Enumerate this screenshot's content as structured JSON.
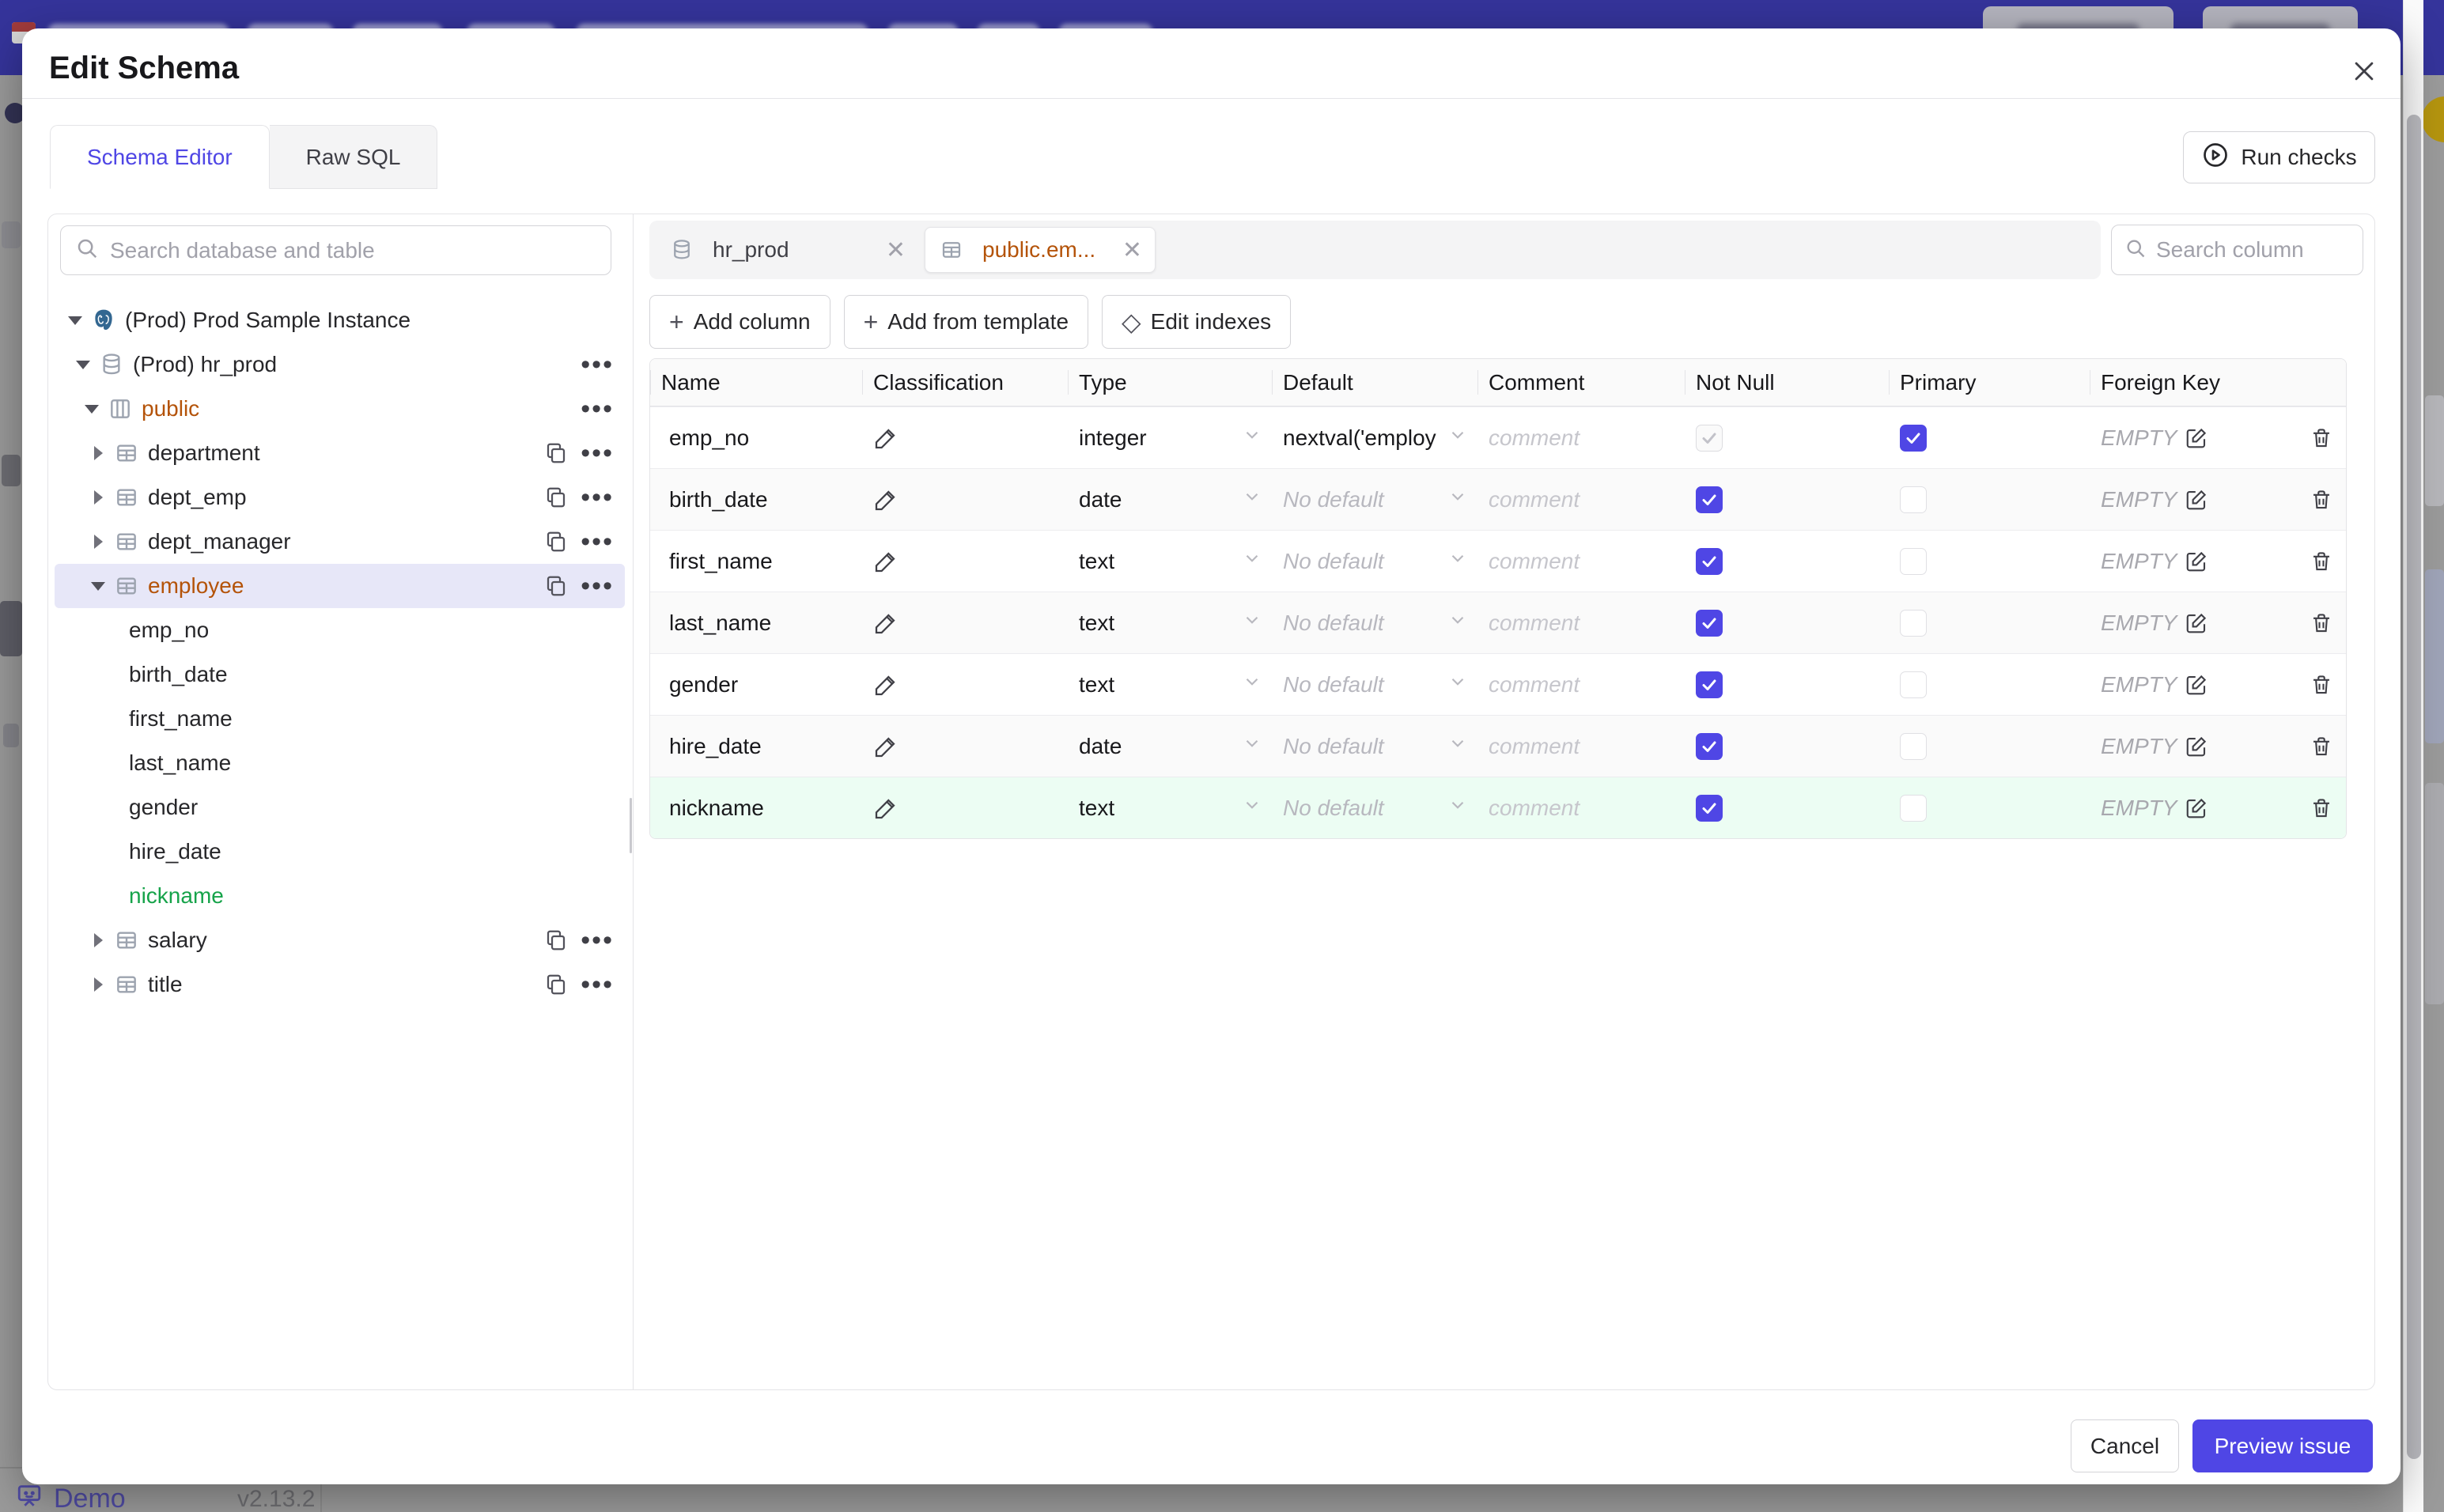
{
  "colors": {
    "accent": "#4f46e5",
    "schema_amber": "#b45309",
    "added_green": "#16a34a",
    "app_header_purple": "#35349b"
  },
  "overlay": {
    "demo_label": "Demo",
    "version": "v2.13.2"
  },
  "modal": {
    "title": "Edit Schema",
    "close_icon": "x",
    "tabs": [
      {
        "label": "Schema Editor",
        "active": true
      },
      {
        "label": "Raw SQL",
        "active": false
      }
    ],
    "run_checks_label": "Run checks",
    "sidebar": {
      "search_placeholder": "Search database and table",
      "tree": [
        {
          "label": "(Prod) Prod Sample Instance",
          "lvl": "lvl0",
          "arrow": "down",
          "icon": "pg"
        },
        {
          "label": "(Prod) hr_prod",
          "lvl": "lvl1",
          "arrow": "down",
          "icon": "db",
          "more": true
        },
        {
          "label": "public",
          "lvl": "lvl2",
          "arrow": "down",
          "icon": "schema",
          "amber": true,
          "more": true
        },
        {
          "label": "department",
          "lvl": "lvl3",
          "arrow": "right",
          "icon": "table",
          "copy": true,
          "more": true
        },
        {
          "label": "dept_emp",
          "lvl": "lvl3",
          "arrow": "right",
          "icon": "table",
          "copy": true,
          "more": true
        },
        {
          "label": "dept_manager",
          "lvl": "lvl3",
          "arrow": "right",
          "icon": "table",
          "copy": true,
          "more": true
        },
        {
          "label": "employee",
          "lvl": "lvl3",
          "arrow": "down",
          "icon": "table",
          "amber": true,
          "selected": true,
          "copy": true,
          "more": true
        },
        {
          "label": "emp_no",
          "lvl": "lvl4",
          "arrow": ""
        },
        {
          "label": "birth_date",
          "lvl": "lvl4",
          "arrow": ""
        },
        {
          "label": "first_name",
          "lvl": "lvl4",
          "arrow": ""
        },
        {
          "label": "last_name",
          "lvl": "lvl4",
          "arrow": ""
        },
        {
          "label": "gender",
          "lvl": "lvl4",
          "arrow": ""
        },
        {
          "label": "hire_date",
          "lvl": "lvl4",
          "arrow": ""
        },
        {
          "label": "nickname",
          "lvl": "lvl4",
          "arrow": "",
          "green": true
        },
        {
          "label": "salary",
          "lvl": "lvl3",
          "arrow": "right",
          "icon": "table",
          "copy": true,
          "more": true
        },
        {
          "label": "title",
          "lvl": "lvl3",
          "arrow": "right",
          "icon": "table",
          "copy": true,
          "more": true
        }
      ]
    },
    "editor": {
      "chips": [
        {
          "label": "hr_prod",
          "icon": "db",
          "active": false,
          "amber": false
        },
        {
          "label": "public.em...",
          "icon": "table",
          "active": true,
          "amber": true
        }
      ],
      "toolbar": [
        {
          "label": "Add column",
          "icon": "plus"
        },
        {
          "label": "Add from template",
          "icon": "plus"
        },
        {
          "label": "Edit indexes",
          "icon": "diamond"
        }
      ],
      "search_placeholder": "Search column",
      "columns_table": {
        "headers": [
          "Name",
          "Classification",
          "Type",
          "Default",
          "Comment",
          "Not Null",
          "Primary",
          "Foreign Key"
        ],
        "comment_placeholder": "comment",
        "fk_empty": "EMPTY",
        "rows": [
          {
            "name": "emp_no",
            "type": "integer",
            "default": "nextval('employ",
            "no_default": false,
            "not_null": true,
            "nn_disabled": true,
            "primary": true,
            "shade": ""
          },
          {
            "name": "birth_date",
            "type": "date",
            "default": "No default",
            "no_default": true,
            "not_null": true,
            "nn_disabled": false,
            "primary": false,
            "shade": "alt"
          },
          {
            "name": "first_name",
            "type": "text",
            "default": "No default",
            "no_default": true,
            "not_null": true,
            "nn_disabled": false,
            "primary": false,
            "shade": ""
          },
          {
            "name": "last_name",
            "type": "text",
            "default": "No default",
            "no_default": true,
            "not_null": true,
            "nn_disabled": false,
            "primary": false,
            "shade": "alt"
          },
          {
            "name": "gender",
            "type": "text",
            "default": "No default",
            "no_default": true,
            "not_null": true,
            "nn_disabled": false,
            "primary": false,
            "shade": ""
          },
          {
            "name": "hire_date",
            "type": "date",
            "default": "No default",
            "no_default": true,
            "not_null": true,
            "nn_disabled": false,
            "primary": false,
            "shade": "alt"
          },
          {
            "name": "nickname",
            "type": "text",
            "default": "No default",
            "no_default": true,
            "not_null": true,
            "nn_disabled": false,
            "primary": false,
            "shade": "green"
          }
        ]
      }
    },
    "footer": {
      "cancel_label": "Cancel",
      "submit_label": "Preview issue"
    }
  }
}
